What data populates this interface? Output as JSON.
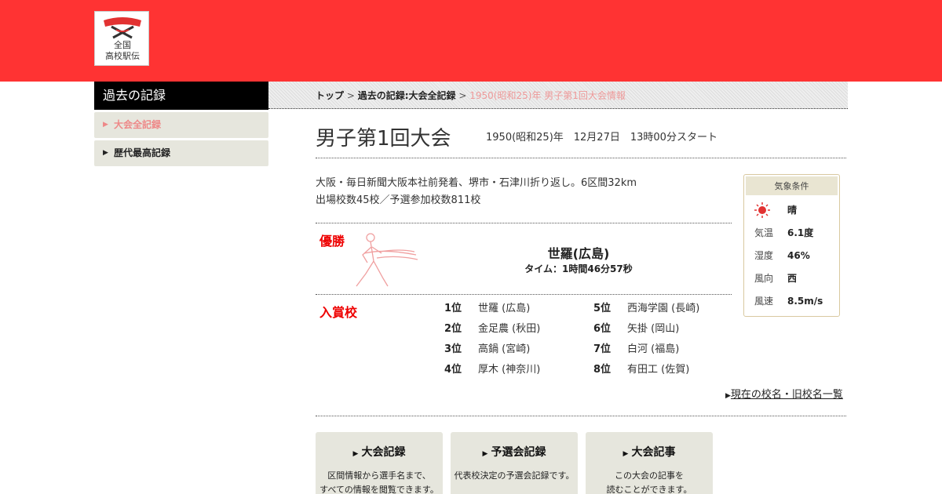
{
  "header": {
    "logo_lines": [
      "全国",
      "高校駅伝"
    ]
  },
  "sidebar": {
    "title": "過去の記録",
    "items": [
      {
        "label": "大会全記録",
        "active": true
      },
      {
        "label": "歴代最高記録",
        "active": false
      }
    ]
  },
  "breadcrumb": {
    "top": "トップ",
    "records": "過去の記録:大会全記録",
    "current": "1950(昭和25)年 男子第1回大会情報",
    "separator": ">"
  },
  "race": {
    "title": "男子第1回大会",
    "date": "1950(昭和25)年　12月27日　13時00分スタート",
    "description": [
      "大阪・毎日新聞大阪本社前発着、堺市・石津川折り返し。6区間32km",
      "出場校数45校／予選参加校数811校"
    ]
  },
  "winner": {
    "label": "優勝",
    "school": "世羅(広島)",
    "time": "タイム：1時間46分57秒"
  },
  "prizes": {
    "label": "入賞校",
    "rows": [
      {
        "rank": "1位",
        "school": "世羅 (広島)"
      },
      {
        "rank": "2位",
        "school": "金足農 (秋田)"
      },
      {
        "rank": "3位",
        "school": "高鍋 (宮崎)"
      },
      {
        "rank": "4位",
        "school": "厚木 (神奈川)"
      },
      {
        "rank": "5位",
        "school": "西海学園 (長崎)"
      },
      {
        "rank": "6位",
        "school": "矢掛 (岡山)"
      },
      {
        "rank": "7位",
        "school": "白河 (福島)"
      },
      {
        "rank": "8位",
        "school": "有田工 (佐賀)"
      }
    ]
  },
  "school_name_link": "現在の校名・旧校名一覧",
  "cards": [
    {
      "title": "大会記録",
      "desc": [
        "区間情報から選手名まで、",
        "すべての情報を閲覧できます。"
      ]
    },
    {
      "title": "予選会記録",
      "desc": [
        "代表校決定の予選会記録です。"
      ]
    },
    {
      "title": "大会記事",
      "desc": [
        "この大会の記事を",
        "読むことができます。"
      ]
    }
  ],
  "weather": {
    "title": "気象条件",
    "rows": [
      {
        "key": "sun-icon",
        "value": "晴"
      },
      {
        "key": "気温",
        "value": "6.1度"
      },
      {
        "key": "湿度",
        "value": "46%"
      },
      {
        "key": "風向",
        "value": "西"
      },
      {
        "key": "風速",
        "value": "8.5m/s"
      }
    ]
  },
  "colors": {
    "header_red": "#ff3333",
    "accent_red": "#e00000",
    "active_pink": "#ee8888"
  }
}
